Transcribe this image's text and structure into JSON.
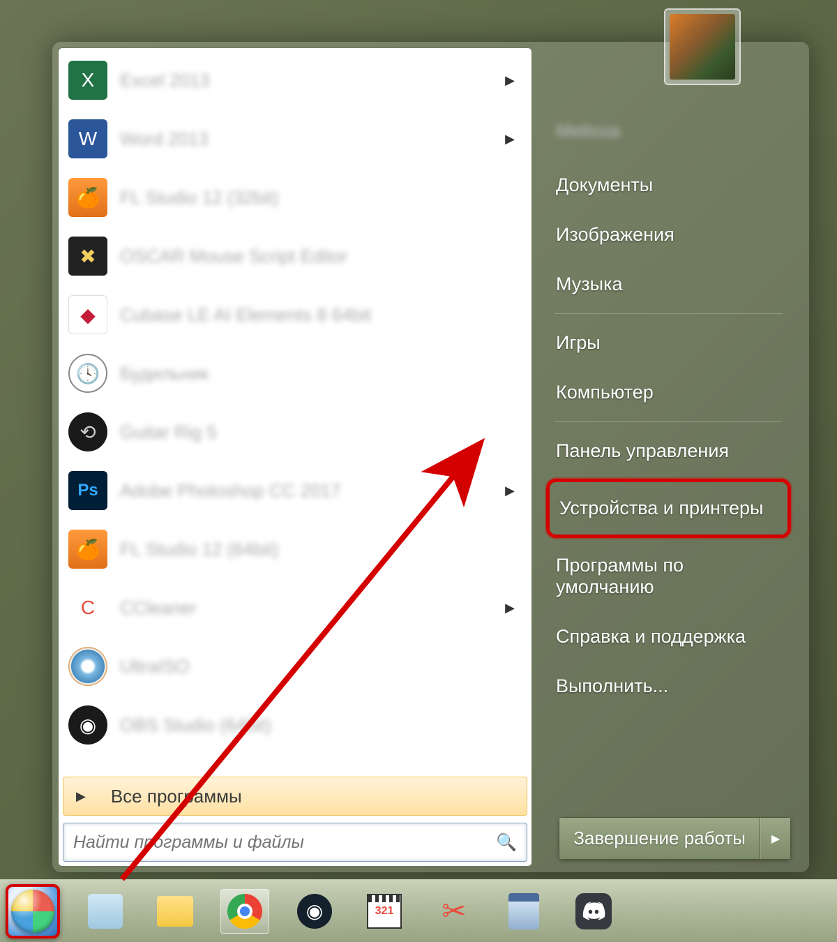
{
  "programs": [
    {
      "label": "Excel 2013",
      "icon": "ic-excel",
      "glyph": "X",
      "arrow": true
    },
    {
      "label": "Word 2013",
      "icon": "ic-word",
      "glyph": "W",
      "arrow": true
    },
    {
      "label": "FL Studio 12 (32bit)",
      "icon": "ic-fl",
      "glyph": "🍊",
      "arrow": false
    },
    {
      "label": "OSCAR Mouse Script Editor",
      "icon": "ic-oscar",
      "glyph": "✖",
      "arrow": false
    },
    {
      "label": "Cubase LE AI Elements 8 64bit",
      "icon": "ic-cubase",
      "glyph": "◆",
      "arrow": false
    },
    {
      "label": "Будильник",
      "icon": "ic-clock",
      "glyph": "🕓",
      "arrow": false
    },
    {
      "label": "Guitar Rig 5",
      "icon": "ic-guitar",
      "glyph": "⟲",
      "arrow": false
    },
    {
      "label": "Adobe Photoshop CC 2017",
      "icon": "ic-ps",
      "glyph": "Ps",
      "arrow": true
    },
    {
      "label": "FL Studio 12 (64bit)",
      "icon": "ic-fl2",
      "glyph": "🍊",
      "arrow": false
    },
    {
      "label": "CCleaner",
      "icon": "ic-ccleaner",
      "glyph": "C",
      "arrow": true
    },
    {
      "label": "UltraISO",
      "icon": "ic-iso",
      "glyph": "",
      "arrow": false
    },
    {
      "label": "OBS Studio (64bit)",
      "icon": "ic-obs",
      "glyph": "◉",
      "arrow": false
    }
  ],
  "all_programs": "Все программы",
  "search_placeholder": "Найти программы и файлы",
  "right_panel": {
    "user": "Melissa",
    "items_top": [
      "Документы",
      "Изображения",
      "Музыка"
    ],
    "items_mid": [
      "Игры",
      "Компьютер"
    ],
    "items_bot": [
      "Панель управления"
    ],
    "highlighted": "Устройства и принтеры",
    "items_last": [
      "Программы по умолчанию",
      "Справка и поддержка",
      "Выполнить..."
    ]
  },
  "shutdown": "Завершение работы",
  "taskbar": [
    {
      "name": "notepad",
      "active": false
    },
    {
      "name": "explorer",
      "active": false
    },
    {
      "name": "chrome",
      "active": true
    },
    {
      "name": "steam",
      "active": false
    },
    {
      "name": "mpc",
      "active": false
    },
    {
      "name": "snipping",
      "active": false
    },
    {
      "name": "calculator",
      "active": false
    },
    {
      "name": "discord",
      "active": false
    }
  ]
}
